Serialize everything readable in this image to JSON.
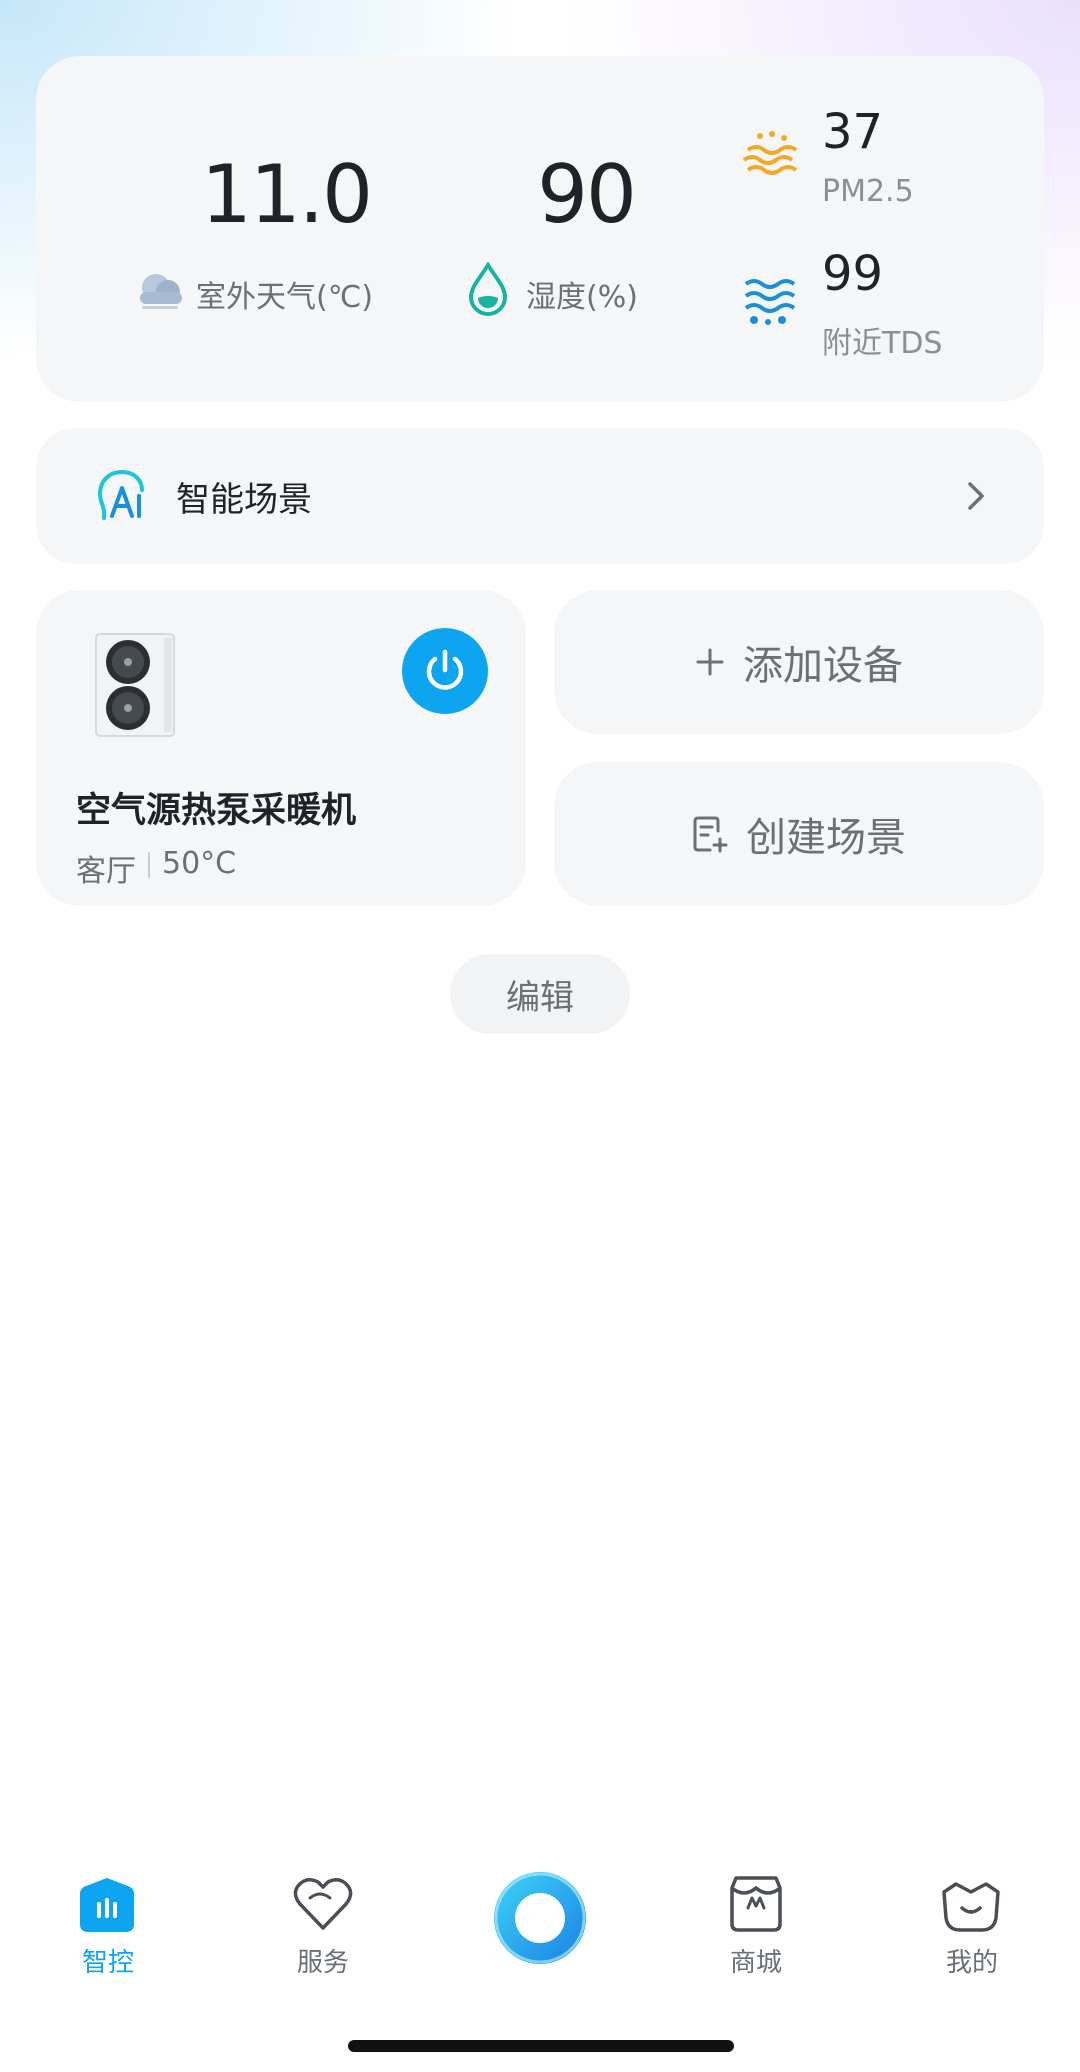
{
  "weather": {
    "outdoor_temp": "11.0",
    "outdoor_label": "室外天气(℃)",
    "humidity": "90",
    "humidity_label": "湿度(%)",
    "pm25_value": "37",
    "pm25_label": "PM2.5",
    "tds_value": "99",
    "tds_label": "附近TDS"
  },
  "scene_bar": {
    "label": "智能场景"
  },
  "device": {
    "name": "空气源热泵采暖机",
    "room": "客厅",
    "temp": "50°C"
  },
  "actions": {
    "add_device": "添加设备",
    "create_scene": "创建场景"
  },
  "edit_label": "编辑",
  "nav": {
    "control": "智控",
    "service": "服务",
    "mall": "商城",
    "mine": "我的"
  },
  "colors": {
    "accent": "#0ea5f0",
    "pm_orange": "#f5a623",
    "tds_blue": "#1a8fdc",
    "humidity_teal": "#17b3a3"
  }
}
